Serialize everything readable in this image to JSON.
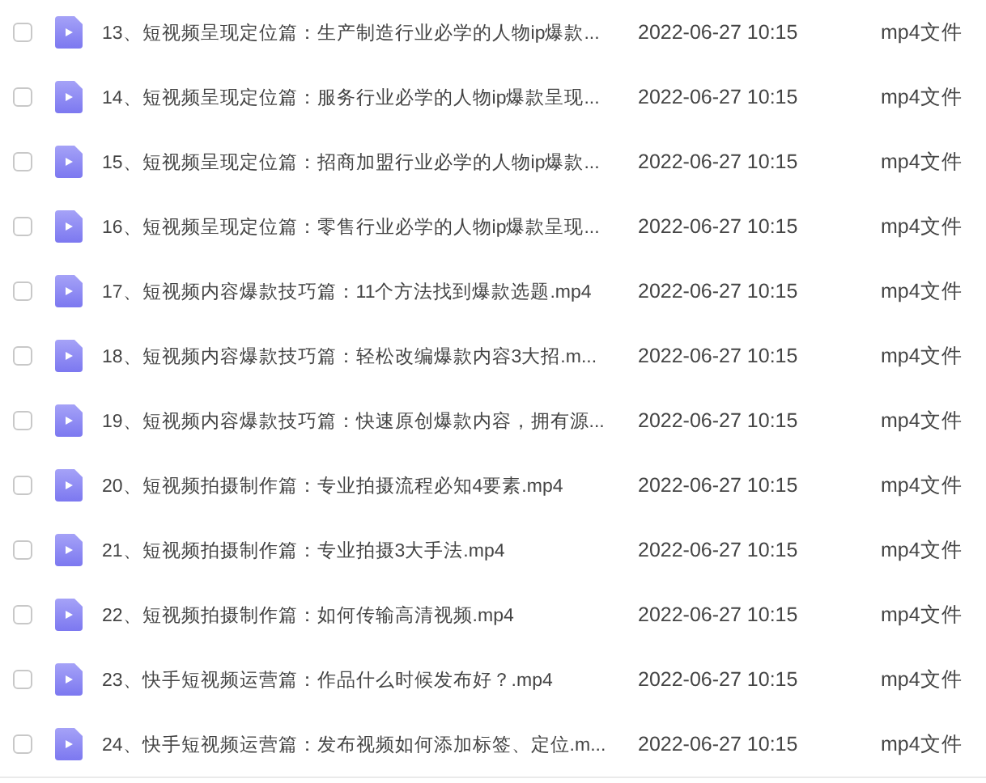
{
  "files": [
    {
      "name": "13、短视频呈现定位篇：生产制造行业必学的人物ip爆款...",
      "date": "2022-06-27 10:15",
      "type": "mp4文件",
      "checked": false
    },
    {
      "name": "14、短视频呈现定位篇：服务行业必学的人物ip爆款呈现...",
      "date": "2022-06-27 10:15",
      "type": "mp4文件",
      "checked": false
    },
    {
      "name": "15、短视频呈现定位篇：招商加盟行业必学的人物ip爆款...",
      "date": "2022-06-27 10:15",
      "type": "mp4文件",
      "checked": false
    },
    {
      "name": "16、短视频呈现定位篇：零售行业必学的人物ip爆款呈现...",
      "date": "2022-06-27 10:15",
      "type": "mp4文件",
      "checked": false
    },
    {
      "name": "17、短视频内容爆款技巧篇：11个方法找到爆款选题.mp4",
      "date": "2022-06-27 10:15",
      "type": "mp4文件",
      "checked": false
    },
    {
      "name": "18、短视频内容爆款技巧篇：轻松改编爆款内容3大招.m...",
      "date": "2022-06-27 10:15",
      "type": "mp4文件",
      "checked": false
    },
    {
      "name": "19、短视频内容爆款技巧篇：快速原创爆款内容，拥有源...",
      "date": "2022-06-27 10:15",
      "type": "mp4文件",
      "checked": false
    },
    {
      "name": "20、短视频拍摄制作篇：专业拍摄流程必知4要素.mp4",
      "date": "2022-06-27 10:15",
      "type": "mp4文件",
      "checked": false
    },
    {
      "name": "21、短视频拍摄制作篇：专业拍摄3大手法.mp4",
      "date": "2022-06-27 10:15",
      "type": "mp4文件",
      "checked": false
    },
    {
      "name": "22、短视频拍摄制作篇：如何传输高清视频.mp4",
      "date": "2022-06-27 10:15",
      "type": "mp4文件",
      "checked": false
    },
    {
      "name": "23、快手短视频运营篇：作品什么时候发布好？.mp4",
      "date": "2022-06-27 10:15",
      "type": "mp4文件",
      "checked": false
    },
    {
      "name": "24、快手短视频运营篇：发布视频如何添加标签、定位.m...",
      "date": "2022-06-27 10:15",
      "type": "mp4文件",
      "checked": false
    }
  ]
}
